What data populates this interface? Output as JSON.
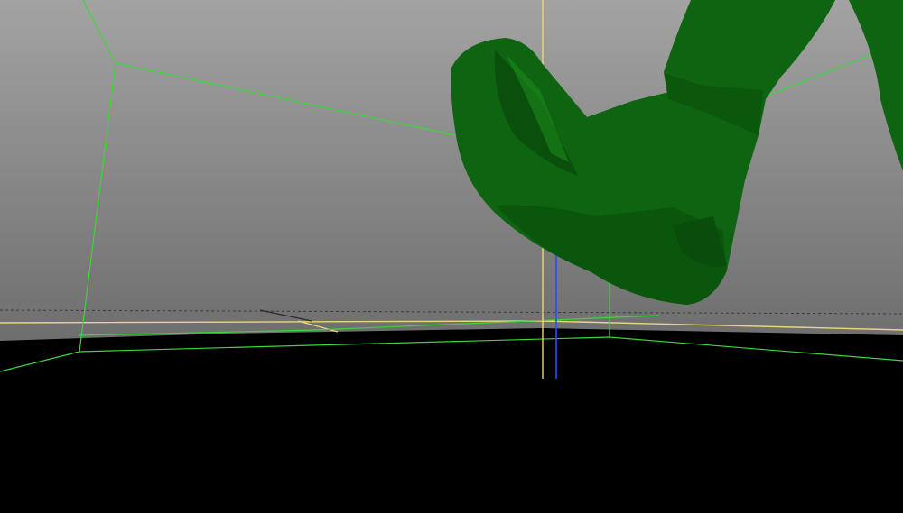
{
  "viewport": {
    "colors": {
      "sky_top": "#a3a3a3",
      "sky_bottom": "#6e6e6e",
      "floor": "#000000",
      "model_green": "#0e6410",
      "model_green_dark": "#0a4f0c",
      "model_green_light": "#1a8a1c",
      "wireframe": "#39d839",
      "axis_yellow": "#e8d77a",
      "axis_blue": "#2a4cff",
      "horizon_dashed": "#3a3a3a"
    }
  }
}
